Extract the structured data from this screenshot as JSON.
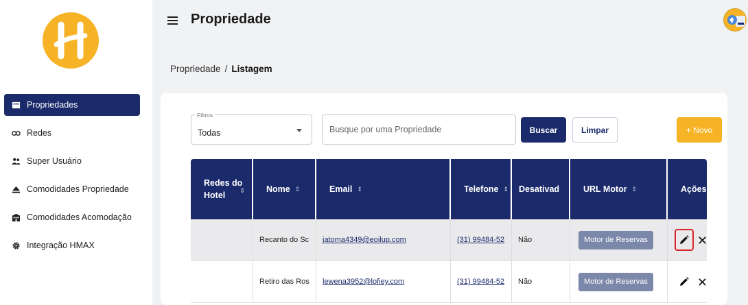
{
  "header": {
    "title": "Propriedade"
  },
  "breadcrumb": {
    "parent": "Propriedade",
    "separator": "/",
    "current": "Listagem"
  },
  "sidebar": {
    "items": [
      {
        "label": "Propriedades",
        "icon": "building-icon",
        "active": true
      },
      {
        "label": "Redes",
        "icon": "link-icon",
        "active": false
      },
      {
        "label": "Super Usuário",
        "icon": "users-icon",
        "active": false
      },
      {
        "label": "Comodidades Propriedade",
        "icon": "eject-icon",
        "active": false
      },
      {
        "label": "Comodidades Acomodação",
        "icon": "hotel-icon",
        "active": false
      },
      {
        "label": "Integração HMAX",
        "icon": "gear-icon",
        "active": false
      }
    ]
  },
  "filters": {
    "label": "Filtros",
    "value": "Todas",
    "search_placeholder": "Busque por uma Propriedade",
    "search_value": "",
    "buscar": "Buscar",
    "limpar": "Limpar",
    "novo": "+ Novo"
  },
  "table": {
    "columns": [
      "Redes do Hotel",
      "Nome",
      "Email",
      "Telefone",
      "Desativad",
      "URL Motor",
      "Ações"
    ],
    "rows": [
      {
        "rede": "",
        "nome": "Recanto do Sc",
        "email": "jatoma4349@eoilup.com",
        "telefone": "(31) 99484-52",
        "desativado": "Não",
        "url_motor": "Motor de Reservas"
      },
      {
        "rede": "",
        "nome": "Retiro das Ros",
        "email": "lewena3952@lofiey.com",
        "telefone": "(31) 99484-52",
        "desativado": "Não",
        "url_motor": "Motor de Reservas"
      }
    ]
  },
  "colors": {
    "primary": "#1b2a6b",
    "accent": "#f6b325",
    "highlight": "#d8262b"
  }
}
